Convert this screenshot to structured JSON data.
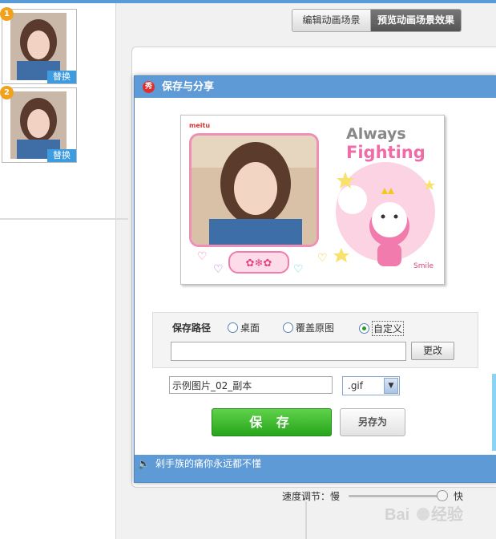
{
  "thumbnails": [
    {
      "index": "1",
      "replace_label": "替换"
    },
    {
      "index": "2",
      "replace_label": "替换"
    }
  ],
  "tabs": [
    {
      "label": "编辑动画场景",
      "active": false
    },
    {
      "label": "预览动画场景效果",
      "active": true
    }
  ],
  "dialog": {
    "title": "保存与分享",
    "icon": "秀",
    "preview": {
      "brand": "meitu",
      "line1": "Always",
      "line2": "Fighting"
    },
    "save_path_label": "保存路径",
    "radios": [
      {
        "label": "桌面",
        "checked": false
      },
      {
        "label": "覆盖原图",
        "checked": false
      },
      {
        "label": "自定义",
        "checked": true
      }
    ],
    "path_value": "",
    "change_label": "更改",
    "filename": "示例图片_02_副本",
    "extension": ".gif",
    "save_label": "保 存",
    "save_as_label": "另存为",
    "footer_text": "剁手族的痛你永远都不懂"
  },
  "speed": {
    "label": "速度调节：慢",
    "fast_label": "快",
    "value": 0.95
  },
  "colors": {
    "accent": "#5d9ad6",
    "save_green": "#3cbf2c",
    "badge_orange": "#f0a21c"
  }
}
